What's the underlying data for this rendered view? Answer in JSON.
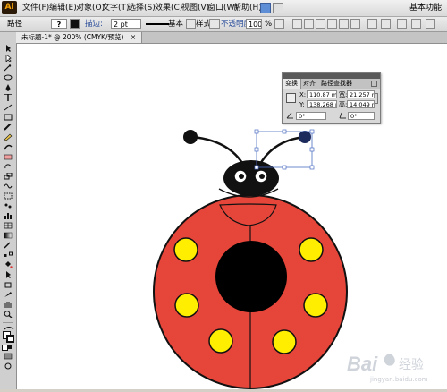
{
  "app": {
    "logo": "Ai"
  },
  "menu": {
    "items": [
      "文件(F)",
      "编辑(E)",
      "对象(O)",
      "文字(T)",
      "选择(S)",
      "效果(C)",
      "视图(V)",
      "窗口(W)",
      "帮助(H)"
    ],
    "workspace": "基本功能"
  },
  "control_bar": {
    "selection_type": "路径",
    "fill_symbol": "?",
    "stroke_label": "描边:",
    "stroke_weight": "2 pt",
    "brush_label": "基本",
    "style_label": "样式:",
    "opacity_label": "不透明度:",
    "opacity_value": "100",
    "opacity_unit": "%"
  },
  "document_tab": {
    "title": "未标题-1* @ 200% (CMYK/预览)",
    "close": "×"
  },
  "transform_panel": {
    "tabs": [
      "变换",
      "对齐",
      "路径查找器"
    ],
    "x_label": "X:",
    "x_value": "110.87 mm",
    "y_label": "Y:",
    "y_value": "138.268 mm",
    "w_label": "宽:",
    "w_value": "21.257 mm",
    "h_label": "高:",
    "h_value": "14.049 mm",
    "rotate_value": "0°",
    "shear_value": "0°"
  },
  "colors": {
    "ladybug_body": "#e6453a",
    "spots": "#ffee00",
    "outline": "#111111",
    "selection": "#4a6cc2",
    "accent_orange": "#f7a30a"
  },
  "watermark": {
    "brand_prefix": "Bai",
    "brand_suffix": "经验",
    "url": "jingyan.baidu.com"
  }
}
